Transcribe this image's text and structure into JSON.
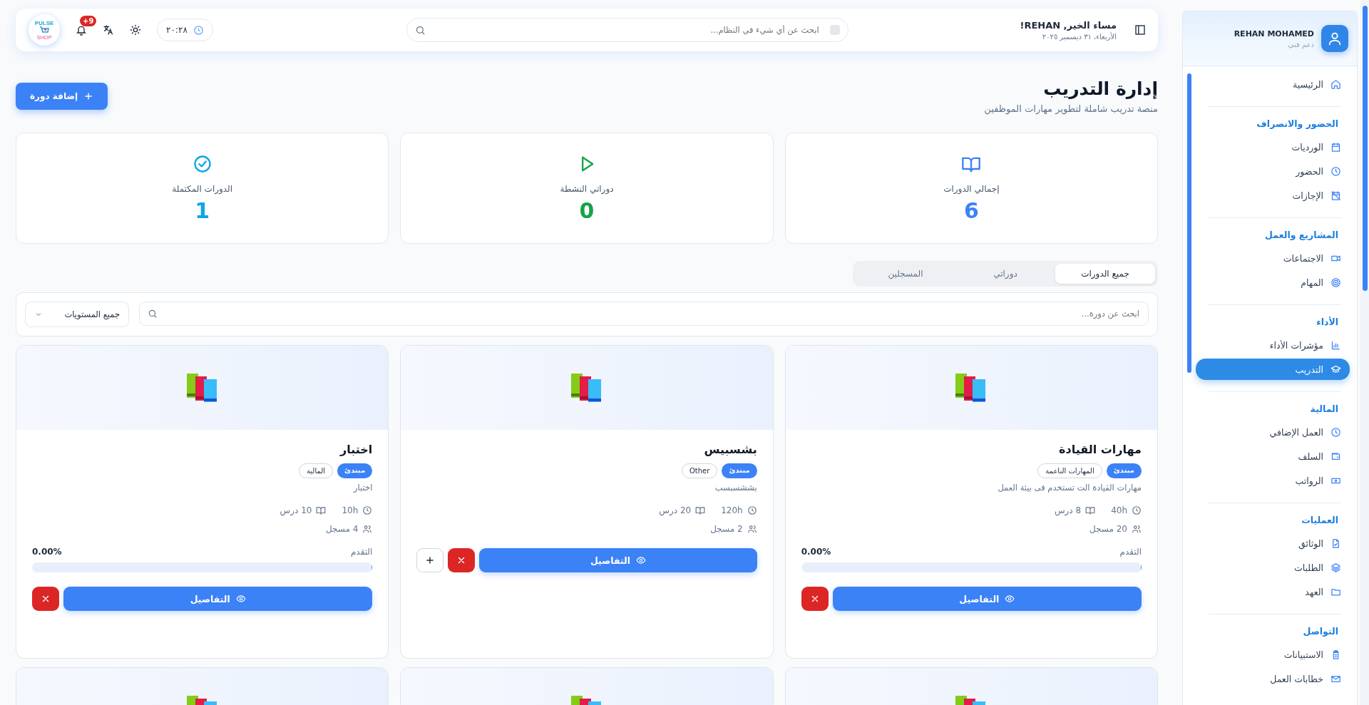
{
  "topbar": {
    "logo": {
      "top": "PULSE",
      "bottom": "SHOP"
    },
    "notifications": "+9",
    "time": "٢٠:٢٨",
    "search": {
      "placeholder": "ابحث عن أي شيء في النظام..."
    },
    "greeting": "مساء الخير, REHAN!",
    "date": "الأربعاء، ٣١ ديسمبر ٢٠٢٥"
  },
  "sidebar": {
    "user": {
      "name": "REHAN MOHAMED",
      "role": "دعم فني"
    },
    "sections": [
      {
        "items": [
          {
            "label": "الرئيسية",
            "selected": false
          }
        ]
      },
      {
        "title": "الحضور والانصراف",
        "items": [
          {
            "label": "الورديات",
            "selected": false
          },
          {
            "label": "الحضور",
            "selected": false
          },
          {
            "label": "الإجازات",
            "selected": false
          }
        ]
      },
      {
        "title": "المشاريع والعمل",
        "items": [
          {
            "label": "الاجتماعات",
            "selected": false
          },
          {
            "label": "المهام",
            "selected": false
          }
        ]
      },
      {
        "title": "الأداء",
        "items": [
          {
            "label": "مؤشرات الأداء",
            "selected": false
          },
          {
            "label": "التدريب",
            "selected": true
          }
        ]
      },
      {
        "title": "المالية",
        "items": [
          {
            "label": "العمل الإضافي",
            "selected": false
          },
          {
            "label": "السلف",
            "selected": false
          },
          {
            "label": "الرواتب",
            "selected": false
          }
        ]
      },
      {
        "title": "العمليات",
        "items": [
          {
            "label": "الوثائق",
            "selected": false
          },
          {
            "label": "الطلبات",
            "selected": false
          },
          {
            "label": "العهد",
            "selected": false
          }
        ]
      },
      {
        "title": "التواصل",
        "items": [
          {
            "label": "الاستبيانات",
            "selected": false
          },
          {
            "label": "خطابات العمل",
            "selected": false
          }
        ]
      }
    ]
  },
  "header": {
    "title": "إدارة التدريب",
    "subtitle": "منصة تدريب شاملة لتطوير مهارات الموظفين",
    "add_button": "إضافة دورة"
  },
  "stats": [
    {
      "kind": "book",
      "label": "إجمالي الدورات",
      "value": "6",
      "color": "#3b82f6"
    },
    {
      "kind": "play",
      "label": "دوراتي النشطة",
      "value": "0",
      "color": "#16a34a"
    },
    {
      "kind": "check",
      "label": "الدورات المكتملة",
      "value": "1",
      "color": "#0ea5e9"
    }
  ],
  "tabs": [
    {
      "label": "جميع الدورات",
      "selected": true
    },
    {
      "label": "دوراتي",
      "selected": false
    },
    {
      "label": "المسجلين",
      "selected": false
    }
  ],
  "filters": {
    "search": {
      "placeholder": "ابحث عن دورة..."
    },
    "level_select": "جميع المستويات"
  },
  "courses": [
    {
      "title": "مهارات القيادة",
      "tags": [
        {
          "kind": "level",
          "label": "مبتدئ"
        },
        {
          "kind": "category",
          "label": "المهارات الناعمة"
        }
      ],
      "description": "مهارات القيادة الت تستخدم فى بيئة العمل",
      "hours": "40h",
      "lessons": "8 درس",
      "enrolled": "20 مسجل",
      "progress": {
        "label": "التقدم",
        "value": "0.00%",
        "level": 0
      },
      "details_button": "التفاصيل",
      "actions": [
        {
          "kind": "delete"
        }
      ]
    },
    {
      "title": "بشسبيس",
      "tags": [
        {
          "kind": "level",
          "label": "مبتدئ"
        },
        {
          "kind": "category",
          "label": "Other"
        }
      ],
      "description": "بششسبسب",
      "hours": "120h",
      "lessons": "20 درس",
      "enrolled": "2 مسجل",
      "details_button": "التفاصيل",
      "actions": [
        {
          "kind": "delete"
        },
        {
          "kind": "add"
        }
      ]
    },
    {
      "title": "اختبار",
      "tags": [
        {
          "kind": "level",
          "label": "مبتدئ"
        },
        {
          "kind": "category",
          "label": "المالية"
        }
      ],
      "description": "اختبار",
      "hours": "10h",
      "lessons": "10 درس",
      "enrolled": "4 مسجل",
      "progress": {
        "label": "التقدم",
        "value": "0.00%",
        "level": 0
      },
      "details_button": "التفاصيل",
      "actions": [
        {
          "kind": "delete"
        }
      ]
    }
  ],
  "more_courses": [
    {
      "kind": "books"
    },
    {
      "kind": "books"
    },
    {
      "kind": "books"
    }
  ]
}
